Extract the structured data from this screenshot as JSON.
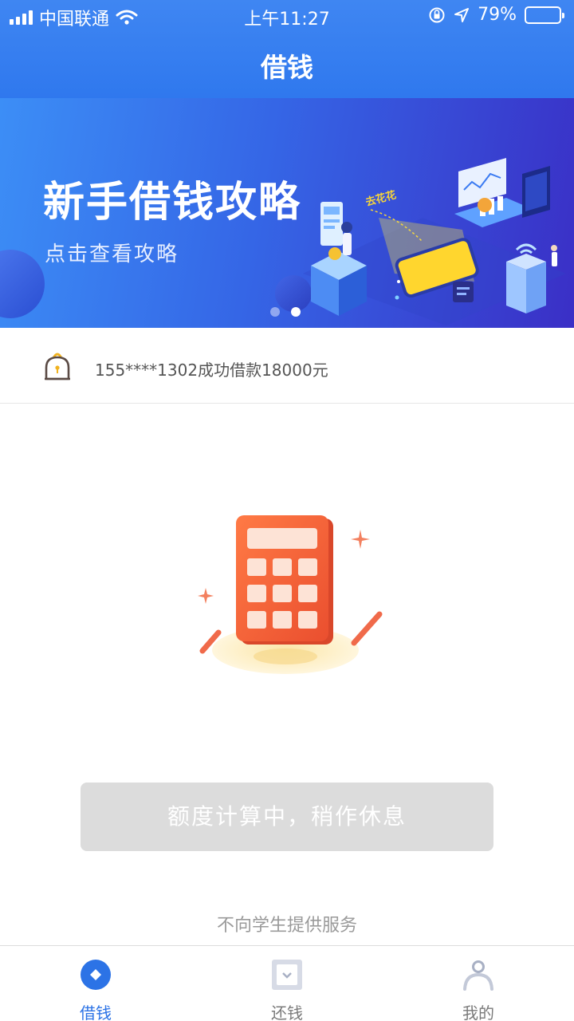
{
  "status_bar": {
    "carrier": "中国联通",
    "time": "上午11:27",
    "battery": "79%",
    "battery_level": 0.79
  },
  "header": {
    "title": "借钱"
  },
  "banner": {
    "headline": "新手借钱攻略",
    "subtitle": "点击查看攻略",
    "slides": 2,
    "active_slide": 2
  },
  "notice": {
    "text": "155****1302成功借款18000元",
    "icon": "lock-bell-icon"
  },
  "main": {
    "illustration": "calculator-icon",
    "button_label": "额度计算中，稍作休息",
    "footnote": "不向学生提供服务"
  },
  "tabbar": {
    "tabs": [
      {
        "label": "借钱",
        "icon": "borrow-icon",
        "active": true
      },
      {
        "label": "还钱",
        "icon": "repay-icon",
        "active": false
      },
      {
        "label": "我的",
        "icon": "profile-icon",
        "active": false
      }
    ]
  },
  "colors": {
    "primary": "#2f78ee",
    "active_tab": "#2c73e6",
    "button_disabled": "#dcdcdc",
    "calculator": "#f2623a"
  }
}
